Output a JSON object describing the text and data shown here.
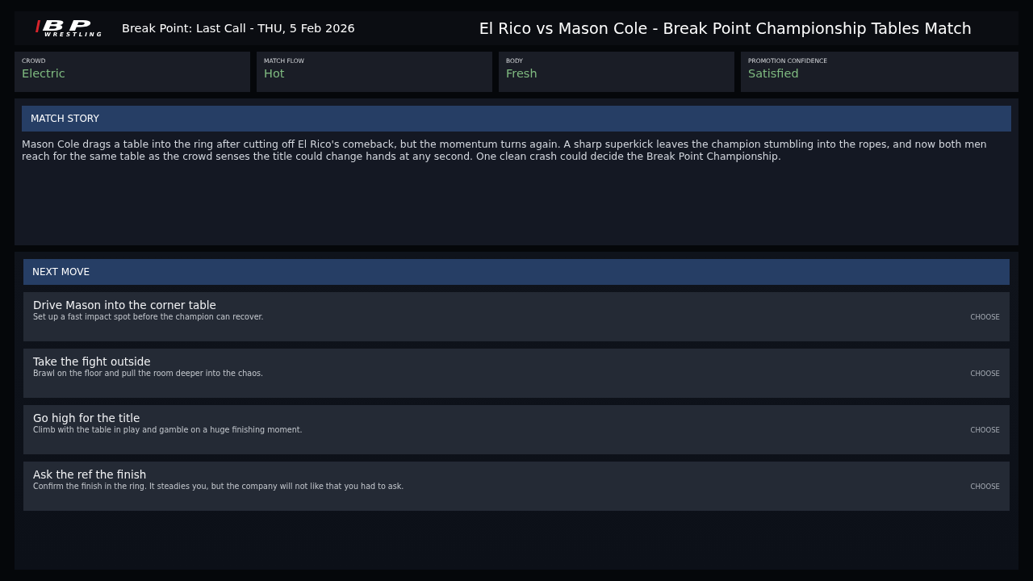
{
  "header": {
    "logo": {
      "mark": "BP",
      "tagline": "WRESTLING"
    },
    "event": "Break Point: Last Call - THU, 5 Feb 2026",
    "match_title": "El Rico vs Mason Cole - Break Point Championship Tables Match"
  },
  "stats": [
    {
      "label": "CROWD",
      "value": "Electric"
    },
    {
      "label": "MATCH FLOW",
      "value": "Hot"
    },
    {
      "label": "BODY",
      "value": "Fresh"
    },
    {
      "label": "PROMOTION CONFIDENCE",
      "value": "Satisfied"
    }
  ],
  "match_story": {
    "heading": "MATCH STORY",
    "text": "Mason Cole drags a table into the ring after cutting off El Rico's comeback, but the momentum turns again. A sharp superkick leaves the champion stumbling into the ropes, and now both men reach for the same table as the crowd senses the title could change hands at any second. One clean crash could decide the Break Point Championship."
  },
  "next_move": {
    "heading": "NEXT MOVE",
    "options": [
      {
        "title": "Drive Mason into the corner table",
        "description": "Set up a fast impact spot before the champion can recover.",
        "action": "CHOOSE"
      },
      {
        "title": "Take the fight outside",
        "description": "Brawl on the floor and pull the room deeper into the chaos.",
        "action": "CHOOSE"
      },
      {
        "title": "Go high for the title",
        "description": "Climb with the table in play and gamble on a huge finishing moment.",
        "action": "CHOOSE"
      },
      {
        "title": "Ask the ref the finish",
        "description": "Confirm the finish in the ring. It steadies you, but the company will not like that you had to ask.",
        "action": "CHOOSE"
      }
    ]
  }
}
